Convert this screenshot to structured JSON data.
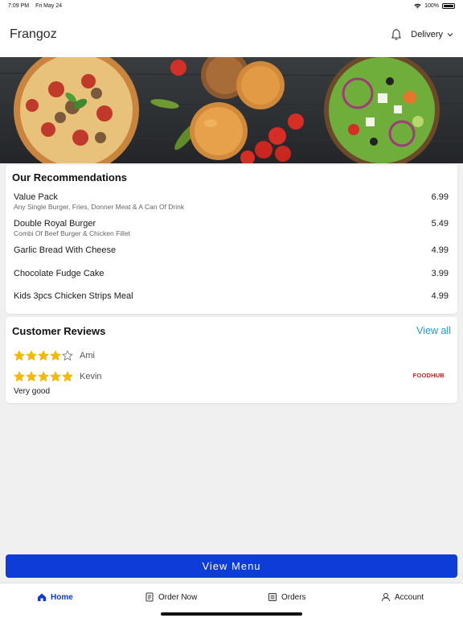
{
  "status_bar": {
    "time": "7:09 PM",
    "date": "Fri May 24",
    "battery": "100%",
    "battery_level": 1.0
  },
  "header": {
    "title": "Frangoz",
    "delivery_label": "Delivery",
    "bell_icon": "bell-icon",
    "chevron_icon": "chevron-down-icon"
  },
  "recommendations": {
    "title": "Our Recommendations",
    "items": [
      {
        "name": "Value Pack",
        "description": "Any Single Burger, Fries, Donner Meat & A Can Of Drink",
        "price": "6.99"
      },
      {
        "name": "Double Royal Burger",
        "description": "Combi Of Beef Burger & Chicken Fillet",
        "price": "5.49"
      },
      {
        "name": "Garlic Bread With Cheese",
        "description": "",
        "price": "4.99"
      },
      {
        "name": "Chocolate Fudge Cake",
        "description": "",
        "price": "3.99"
      },
      {
        "name": "Kids 3pcs Chicken Strips Meal",
        "description": "",
        "price": "4.99"
      }
    ]
  },
  "reviews": {
    "title": "Customer Reviews",
    "view_all": "View all",
    "items": [
      {
        "name": "Ami",
        "rating": 4,
        "max_rating": 5,
        "text": ""
      },
      {
        "name": "Kevin",
        "rating": 5,
        "max_rating": 5,
        "text": "Very good",
        "logo": "FOODHUB"
      }
    ]
  },
  "view_menu_label": "View Menu",
  "tabs": [
    {
      "label": "Home",
      "icon": "home-icon",
      "active": true
    },
    {
      "label": "Order Now",
      "icon": "order-icon",
      "active": false
    },
    {
      "label": "Orders",
      "icon": "orders-list-icon",
      "active": false
    },
    {
      "label": "Account",
      "icon": "account-icon",
      "active": false
    }
  ],
  "colors": {
    "accent": "#0d3cd9",
    "link": "#1a9ad0",
    "star": "#f6b800",
    "brand_red": "#d0201e"
  }
}
